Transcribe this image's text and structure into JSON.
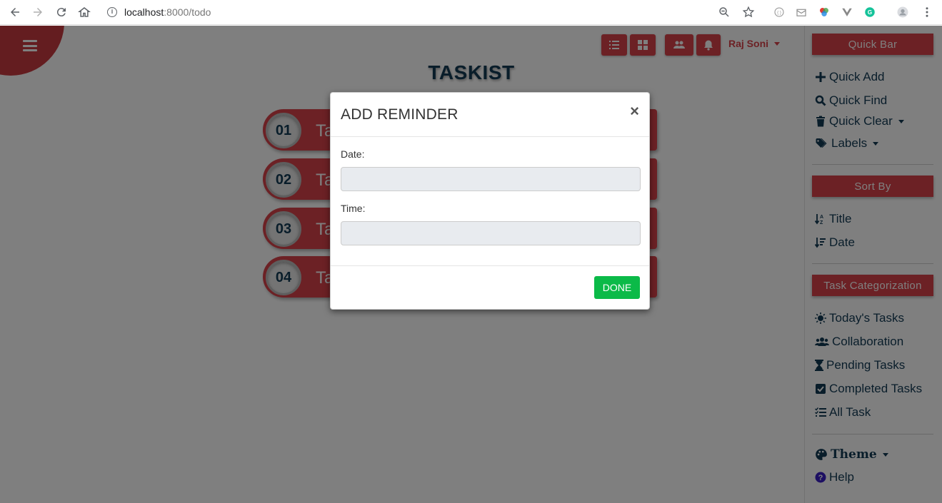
{
  "browser": {
    "url_host": "localhost",
    "url_path": ":8000/todo"
  },
  "header": {
    "user_name": "Raj Soni",
    "app_title": "TASKIST"
  },
  "tasks": [
    {
      "number": "01",
      "label": "Ta"
    },
    {
      "number": "02",
      "label": "Ta"
    },
    {
      "number": "03",
      "label": "Ta"
    },
    {
      "number": "04",
      "label": "Ta"
    }
  ],
  "sidebar": {
    "quick_bar_heading": "Quick Bar",
    "quick_items": [
      "Quick Add",
      "Quick Find",
      "Quick Clear",
      "Labels"
    ],
    "sort_heading": "Sort By",
    "sort_items": [
      "Title",
      "Date"
    ],
    "category_heading": "Task Categorization",
    "category_items": [
      "Today's Tasks",
      "Collaboration",
      "Pending Tasks",
      "Completed Tasks",
      "All Task"
    ],
    "theme_label": "Theme",
    "help_label": "Help"
  },
  "modal": {
    "title": "ADD REMINDER",
    "close_symbol": "×",
    "date_label": "Date:",
    "date_value": "",
    "time_label": "Time:",
    "time_value": "",
    "done_label": "DONE"
  },
  "colors": {
    "accent": "#d9434a",
    "title": "#123a55",
    "done": "#0bba48"
  }
}
